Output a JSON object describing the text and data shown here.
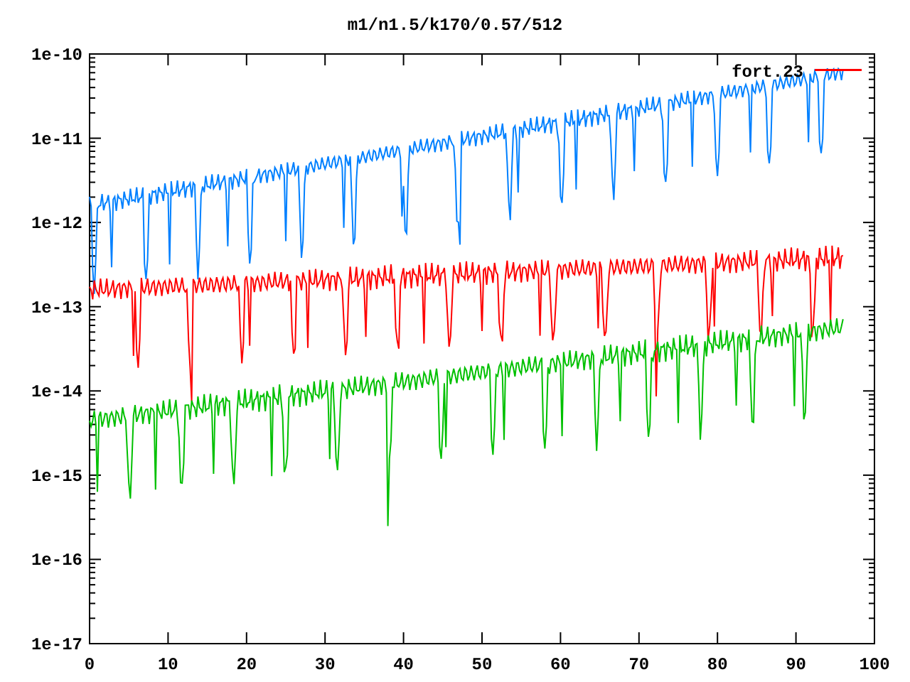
{
  "plot": {
    "title": "m1/n1.5/k170/0.57/512",
    "y_axis_labels": [
      "1e-10",
      "1e-11",
      "1e-12",
      "1e-13",
      "1e-14",
      "1e-15",
      "1e-16",
      "1e-17"
    ],
    "x_axis_labels": [
      "0",
      "10",
      "20",
      "30",
      "40",
      "50",
      "60",
      "70",
      "80",
      "90",
      "100"
    ],
    "legend": [
      {
        "label": "fort.23",
        "color": "#ff0000"
      }
    ]
  }
}
